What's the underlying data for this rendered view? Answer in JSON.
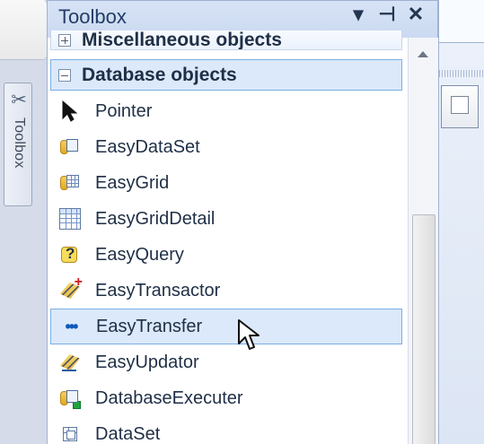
{
  "toolbox": {
    "title": "Toolbox",
    "side_tab_label": "Toolbox",
    "header_buttons": {
      "dropdown": "▾",
      "pin": "⊣",
      "close": "✕"
    },
    "sections": {
      "misc": "Miscellaneous objects",
      "database": "Database objects"
    },
    "items": [
      {
        "label": "Pointer",
        "icon": "pointer-icon"
      },
      {
        "label": "EasyDataSet",
        "icon": "easydataset-icon"
      },
      {
        "label": "EasyGrid",
        "icon": "easygrid-icon"
      },
      {
        "label": "EasyGridDetail",
        "icon": "easygriddetail-icon"
      },
      {
        "label": "EasyQuery",
        "icon": "easyquery-icon"
      },
      {
        "label": "EasyTransactor",
        "icon": "easytransactor-icon"
      },
      {
        "label": "EasyTransfer",
        "icon": "easytransfer-icon"
      },
      {
        "label": "EasyUpdator",
        "icon": "easyupdator-icon"
      },
      {
        "label": "DatabaseExecuter",
        "icon": "databaseexecuter-icon"
      },
      {
        "label": "DataSet",
        "icon": "dataset-icon"
      }
    ]
  }
}
